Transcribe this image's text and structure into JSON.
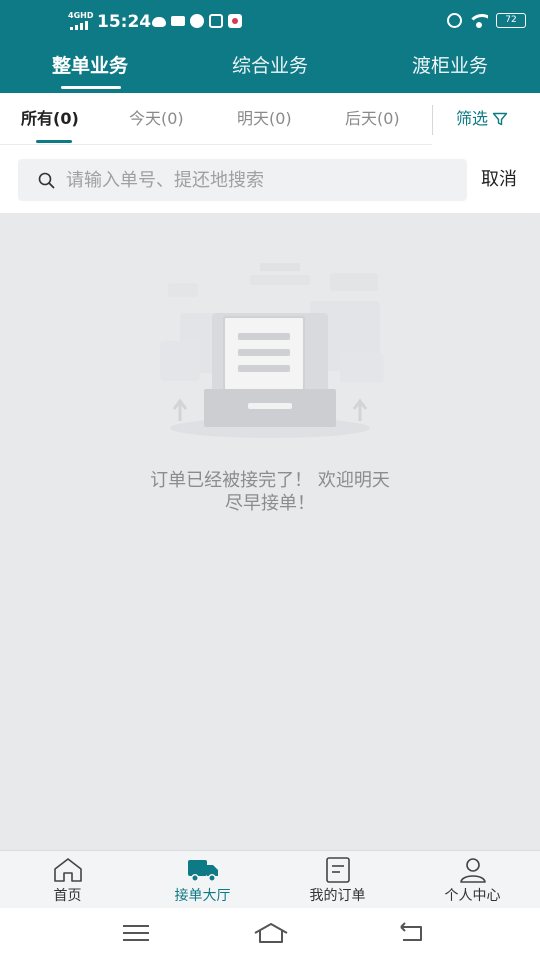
{
  "status_bar": {
    "network": "4GHD",
    "time": "15:24",
    "battery": "72"
  },
  "top_tabs": [
    {
      "label": "整单业务",
      "active": true
    },
    {
      "label": "综合业务",
      "active": false
    },
    {
      "label": "渡柜业务",
      "active": false
    }
  ],
  "filter_tabs": [
    {
      "label": "所有(0)",
      "active": true
    },
    {
      "label": "今天(0)",
      "active": false
    },
    {
      "label": "明天(0)",
      "active": false
    },
    {
      "label": "后天(0)",
      "active": false
    }
  ],
  "filter": {
    "label": "筛选"
  },
  "search": {
    "placeholder": "请输入单号、提还地搜索",
    "value": "",
    "cancel_label": "取消"
  },
  "empty_state": {
    "line1": "订单已经被接完了！ 欢迎明天",
    "line2": "尽早接单！"
  },
  "bottom_nav": [
    {
      "label": "首页",
      "icon": "home-icon",
      "active": false
    },
    {
      "label": "接单大厅",
      "icon": "truck-icon",
      "active": true
    },
    {
      "label": "我的订单",
      "icon": "order-icon",
      "active": false
    },
    {
      "label": "个人中心",
      "icon": "person-icon",
      "active": false
    }
  ],
  "colors": {
    "accent": "#0d7a86",
    "background": "#e8e9eb",
    "muted_text": "#8c8c8c"
  }
}
